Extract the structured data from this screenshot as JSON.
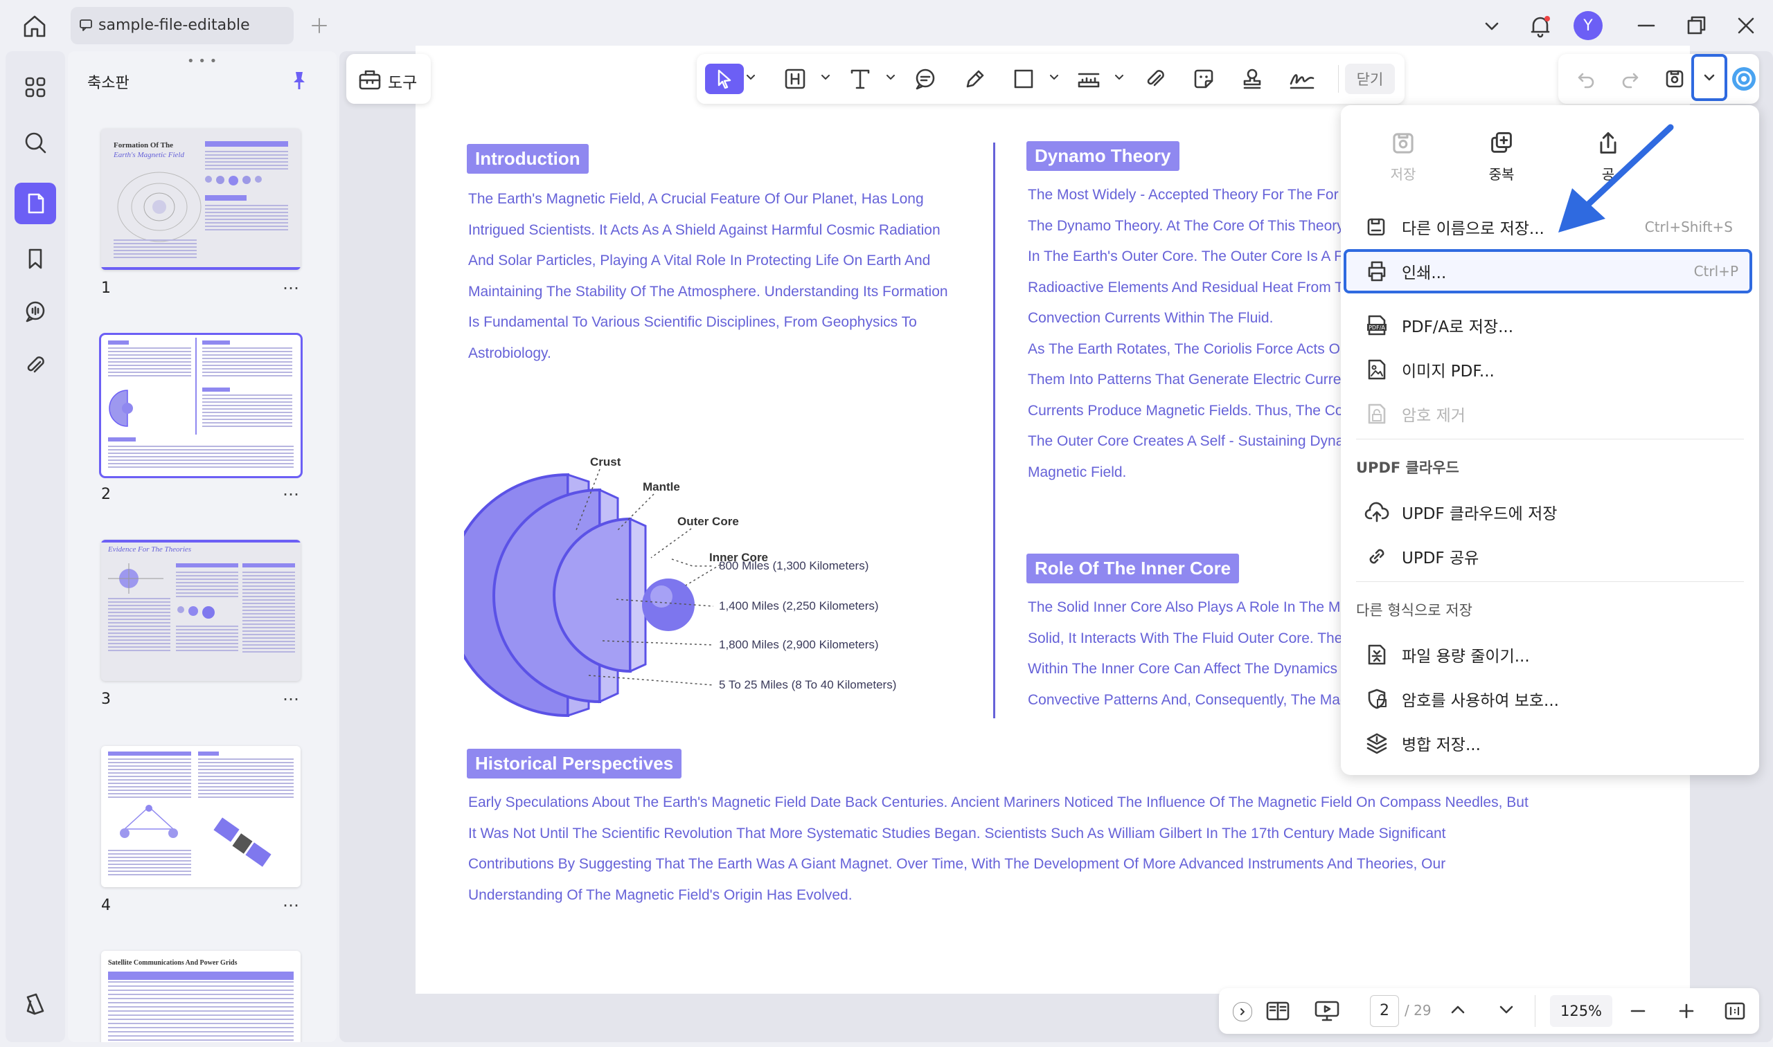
{
  "tab": {
    "title": "sample-file-editable"
  },
  "sidebar": {
    "panel_title": "축소판"
  },
  "thumbnails": [
    {
      "num": "1",
      "more": "…"
    },
    {
      "num": "2",
      "more": "…"
    },
    {
      "num": "3",
      "more": "…"
    },
    {
      "num": "4",
      "more": "…"
    }
  ],
  "thumb_mini": {
    "t1": "Formation Of The",
    "t1b": "Earth's Magnetic Field",
    "t3": "Evidence For The Theories",
    "t5": "Satellite Communications And Power Grids"
  },
  "toolbar": {
    "tools_label": "도구",
    "close_label": "닫기"
  },
  "user": {
    "avatar": "Y"
  },
  "document": {
    "h_intro": "Introduction",
    "p_intro": "The Earth's Magnetic Field, A Crucial Feature Of Our Planet, Has Long Intrigued Scientists. It Acts As A Shield Against Harmful Cosmic Radiation And Solar Particles, Playing A Vital Role In Protecting Life On Earth And Maintaining The Stability Of The Atmosphere. Understanding Its Formation Is Fundamental To Various Scientific Disciplines, From Geophysics To Astrobiology.",
    "l_crust": "Crust",
    "l_mantle": "Mantle",
    "l_outer": "Outer Core",
    "l_inner": "Inner Core",
    "d1": "800 Miles (1,300 Kilometers)",
    "d2": "1,400 Miles (2,250 Kilometers)",
    "d3": "1,800 Miles (2,900 Kilometers)",
    "d4": "5 To 25 Miles (8 To 40 Kilometers)",
    "h_dynamo": "Dynamo Theory",
    "dynamo_lines": [
      "The Most Widely - Accepted Theory For The For",
      "The Dynamo Theory. At The Core Of This Theory",
      "In The Earth's Outer Core. The Outer Core Is A F",
      "Radioactive Elements And Residual Heat From T",
      "Convection Currents Within The Fluid.",
      "As The Earth Rotates, The Coriolis Force Acts O",
      "Them Into Patterns That Generate Electric Curre",
      "Currents Produce Magnetic Fields. Thus, The Co",
      "The Outer Core Creates A Self - Sustaining Dyna",
      "Magnetic Field."
    ],
    "h_inner": "Role Of The Inner Core",
    "inner_lines": [
      "The Solid Inner Core Also Plays A Role In The M",
      "Solid, It Interacts With The Fluid Outer Core. The",
      "Within The Inner Core Can Affect The Dynamics",
      "Convective Patterns And, Consequently, The Mag"
    ],
    "h_hist": "Historical Perspectives",
    "p_hist": "Early Speculations About The Earth's Magnetic Field Date Back Centuries. Ancient Mariners Noticed The Influence Of The Magnetic Field On Compass Needles, But It Was Not Until The Scientific Revolution That More Systematic Studies Began. Scientists Such As William Gilbert In The 17th Century Made Significant Contributions By Suggesting That The Earth Was A Giant Magnet. Over Time, With The Development Of More Advanced Instruments And Theories, Our Understanding Of The Magnetic Field's Origin Has Evolved."
  },
  "menu": {
    "top_save": "저장",
    "top_duplicate": "중복",
    "top_share": "공",
    "save_as": "다른 이름으로 저장...",
    "save_as_short": "Ctrl+Shift+S",
    "print": "인쇄...",
    "print_short": "Ctrl+P",
    "pdfa": "PDF/A로 저장...",
    "image_pdf": "이미지 PDF...",
    "remove_pw": "암호 제거",
    "cloud_section": "UPDF 클라우드",
    "cloud_save": "UPDF 클라우드에 저장",
    "updf_share": "UPDF 공유",
    "other_section": "다른 형식으로 저장",
    "reduce": "파일 용량 줄이기...",
    "protect": "암호를 사용하여 보호...",
    "merge": "병합 저장..."
  },
  "pager": {
    "current": "2",
    "total": "/ 29",
    "zoom": "125%"
  },
  "colors": {
    "accent": "#6c5ff5",
    "doc_text": "#6662d8",
    "heading_bg": "#8f88f0",
    "highlight": "#2f6ae0",
    "arrow": "#2f6ae0"
  }
}
